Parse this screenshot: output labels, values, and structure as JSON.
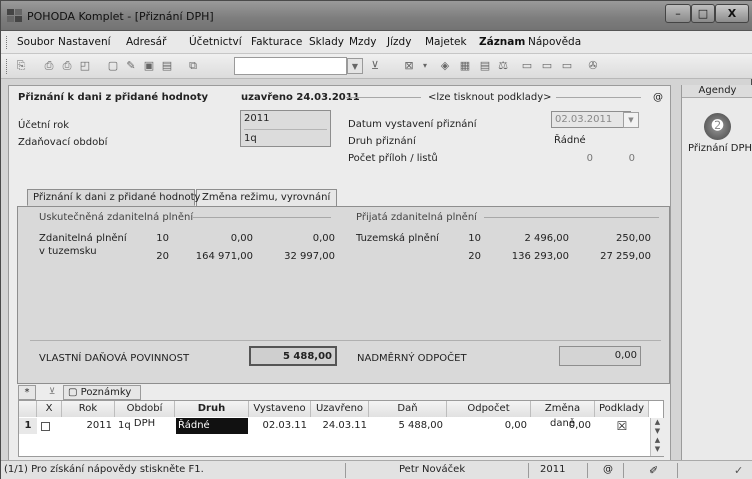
{
  "window": {
    "title": "POHODA Komplet - [Přiznání DPH]",
    "minimize": "–",
    "maximize": "□",
    "close": "X"
  },
  "menu": [
    "Soubor",
    "Nastavení",
    "Adresář",
    "Účetnictví",
    "Fakturace",
    "Sklady",
    "Mzdy",
    "Jízdy",
    "Majetek",
    "Záznam",
    "Nápověda"
  ],
  "header": {
    "title": "Přiznání k dani z přidané hodnoty",
    "status": "uzavřeno 24.03.2011",
    "print_note": "<lze tisknout podklady>",
    "at_symbol": "@"
  },
  "form": {
    "ucetni_rok_label": "Účetní rok",
    "ucetni_rok_value": "2011",
    "zdanovaci_obdobi_label": "Zdaňovací období",
    "zdanovaci_obdobi_value": "1q",
    "datum_label": "Datum vystavení přiznání",
    "datum_value": "02.03.2011",
    "druh_label": "Druh přiznání",
    "druh_value": "Řádné",
    "pocet_label": "Počet příloh / listů",
    "pocet_prilohy": "0",
    "pocet_listy": "0"
  },
  "tabs": [
    "Přiznání k dani z přidané hodnoty",
    "Změna režimu, vyrovnání"
  ],
  "uskutecnena": {
    "title": "Uskutečněná zdanitelná plnění",
    "label_line1": "Zdanitelná plnění",
    "label_line2": "v tuzemsku",
    "rows": [
      {
        "rate": "10",
        "base": "0,00",
        "tax": "0,00"
      },
      {
        "rate": "20",
        "base": "164 971,00",
        "tax": "32 997,00"
      }
    ]
  },
  "prijata": {
    "title": "Přijatá zdanitelná plnění",
    "label": "Tuzemská plnění",
    "rows": [
      {
        "rate": "10",
        "base": "2 496,00",
        "tax": "250,00"
      },
      {
        "rate": "20",
        "base": "136 293,00",
        "tax": "27 259,00"
      }
    ]
  },
  "totals": {
    "vlastni_label": "VLASTNÍ DAŇOVÁ POVINNOST",
    "vlastni_value": "5 488,00",
    "nadmerny_label": "NADMĚRNÝ ODPOČET",
    "nadmerny_value": "0,00"
  },
  "agendy": {
    "title": "Agendy",
    "item": "Přiznání DPH"
  },
  "grid": {
    "tab_asterisk": "*",
    "tab_poznamky": "Poznámky",
    "columns": [
      "X",
      "Rok",
      "Období DPH",
      "Druh",
      "Vystaveno",
      "Uzavřeno",
      "Daň",
      "Odpočet",
      "Změna daně",
      "Podklady"
    ],
    "row": {
      "num": "1",
      "rok": "2011",
      "obdobi": "1q",
      "druh": "Řádné",
      "vystaveno": "02.03.11",
      "uzavreno": "24.03.11",
      "dan": "5 488,00",
      "odpocet": "0,00",
      "zmena": "0,00",
      "podklady": "☒"
    }
  },
  "status": {
    "help": "(1/1) Pro získání nápovědy stiskněte F1.",
    "user": "Petr Nováček",
    "year": "2011",
    "at": "@"
  },
  "colors": {
    "title_bg": "#7d7d7d",
    "panel_bg": "#d9d9d9",
    "selected_cell": "#111111"
  }
}
